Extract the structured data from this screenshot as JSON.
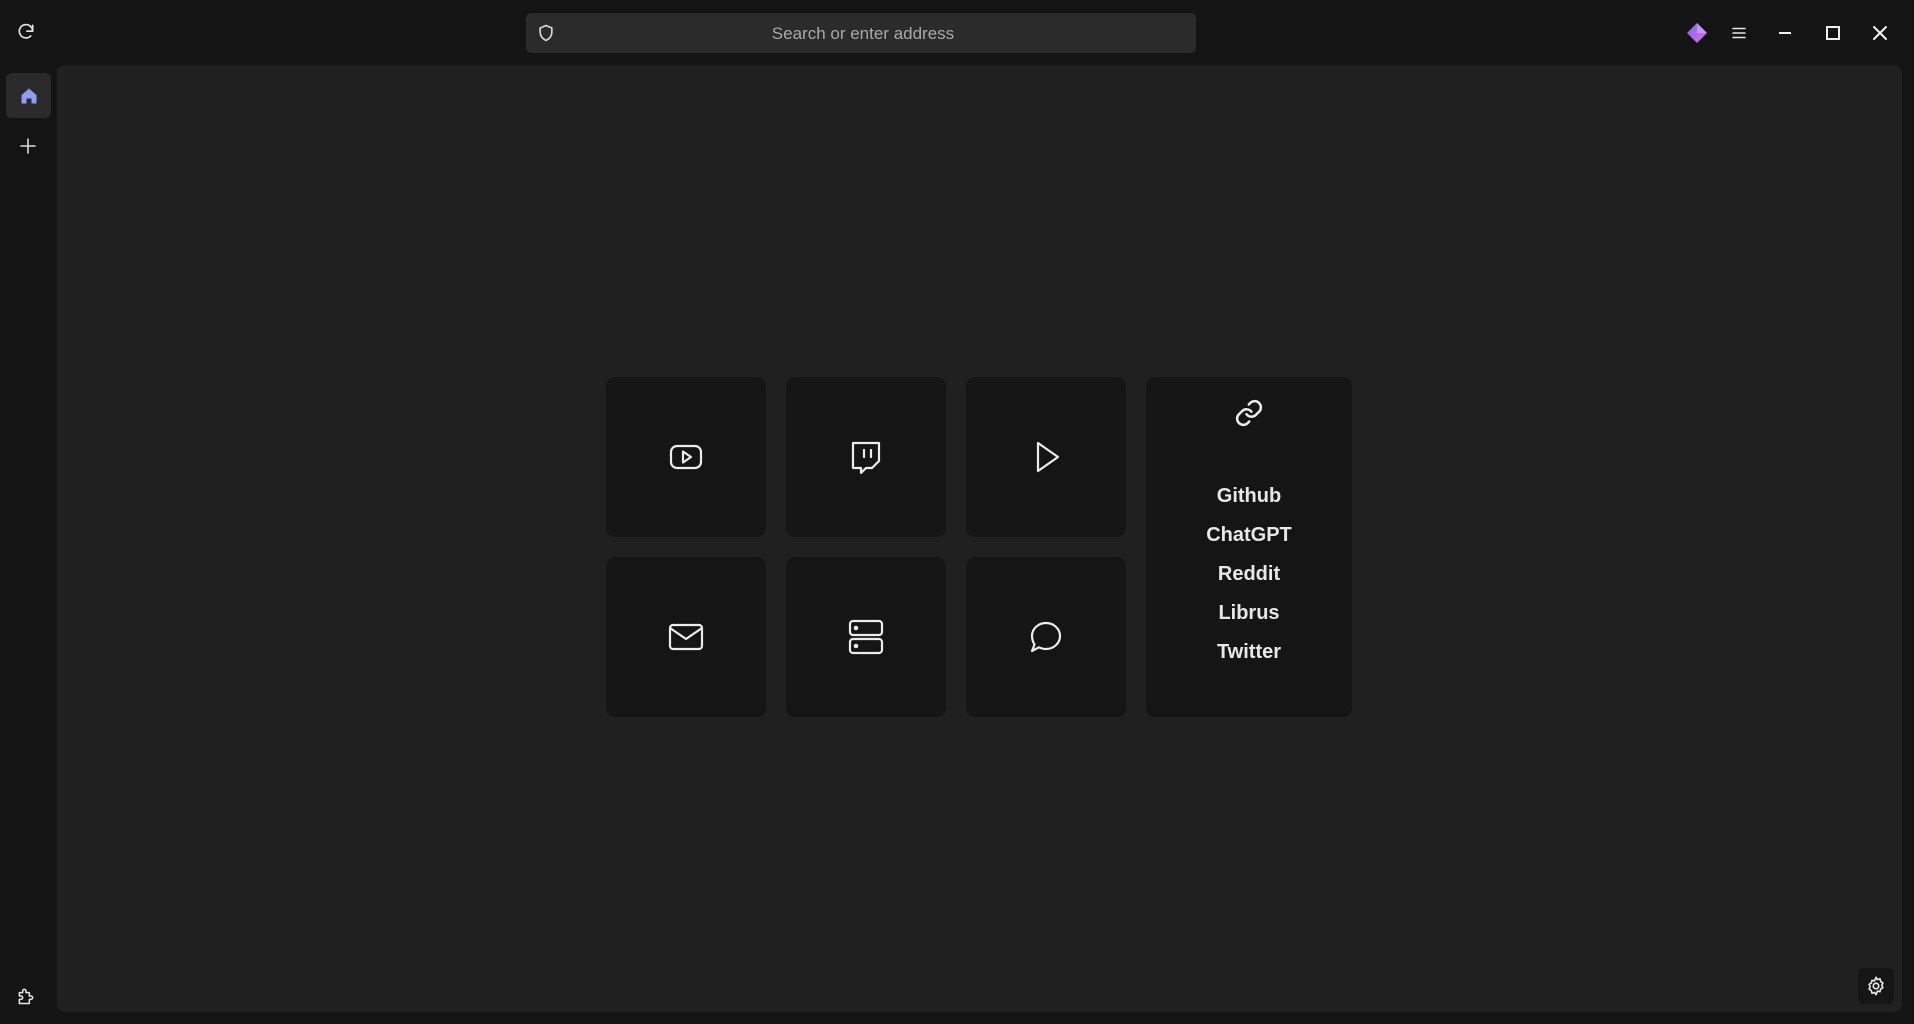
{
  "urlbar": {
    "placeholder": "Search or enter address",
    "value": ""
  },
  "icons": {
    "reload": "reload-icon",
    "shield": "shield-icon",
    "extension_diamond": "diamond-icon",
    "menu": "hamburger-menu-icon",
    "minimize": "minimize-icon",
    "maximize": "maximize-icon",
    "close": "close-icon",
    "home": "home-icon",
    "add": "plus-icon",
    "puzzle": "extension-puzzle-icon",
    "settings": "gear-icon"
  },
  "tiles": [
    {
      "id": "youtube",
      "icon": "youtube-icon"
    },
    {
      "id": "twitch",
      "icon": "twitch-icon"
    },
    {
      "id": "play",
      "icon": "play-icon"
    },
    {
      "id": "mail",
      "icon": "mail-icon"
    },
    {
      "id": "server",
      "icon": "server-icon"
    },
    {
      "id": "chat",
      "icon": "chat-bubble-icon"
    }
  ],
  "links": {
    "icon": "link-icon",
    "items": [
      "Github",
      "ChatGPT",
      "Reddit",
      "Librus",
      "Twitter"
    ]
  },
  "colors": {
    "window_bg": "#141414",
    "content_bg": "#202020",
    "tile_bg": "#151515",
    "home_icon": "#8f9cf0",
    "diamond_gradient_start": "#7b6cf6",
    "diamond_gradient_end": "#e06bd8"
  }
}
